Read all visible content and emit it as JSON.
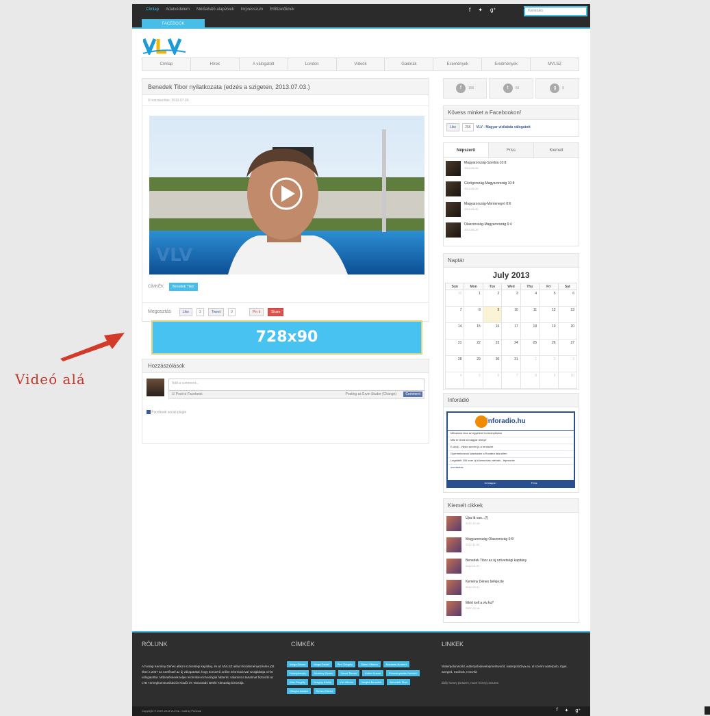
{
  "topbar": {
    "nav": [
      "Címlap",
      "Adatvédelem",
      "Médiaháló alapelvek",
      "Impresszum",
      "Előfizetőknek"
    ],
    "search_placeholder": "Keresés"
  },
  "facebook_tab": "FACEBOOK",
  "main_nav": [
    "Címlap",
    "Hírek",
    "A válogatott",
    "London",
    "Videók",
    "Galériák",
    "Események",
    "Eredmények",
    "MVLSZ"
  ],
  "article": {
    "title": "Benedek Tibor nyilatkozata (edzés a szigeten, 2013.07.03.)",
    "meta": "0 hozzászólás, 2013.07.03.",
    "tags_label": "CÍMKÉK:",
    "tag": "Benedek Tibor",
    "share_label": "Megosztás",
    "like": "Like",
    "like_count": "3",
    "tweet": "Tweet",
    "tweet_count": "0",
    "pin": "Pin it",
    "share": "Share"
  },
  "ad_banner": "728x90",
  "comments": {
    "title": "Hozzászólások",
    "placeholder": "Add a comment...",
    "post_to_fb": "Post to Facebook",
    "posting_as": "Posting as Ervin Studer (Change)",
    "comment_btn": "Comment",
    "plugin": "Facebook social plugin"
  },
  "annotation": "Videó alá",
  "social_counts": [
    {
      "icon": "facebook-icon",
      "glyph": "f",
      "count": "156"
    },
    {
      "icon": "twitter-icon",
      "glyph": "t",
      "count": "60"
    },
    {
      "icon": "googleplus-icon",
      "glyph": "g",
      "count": "0"
    }
  ],
  "facebook_follow": {
    "title": "Kövess minket a Facebookon!",
    "like_btn": "Like",
    "count": "256",
    "page_name": "VLV - Magyar vízilabda válogatott"
  },
  "popular": {
    "tabs": [
      "Népszerű",
      "Friss",
      "Kiemelt"
    ],
    "items": [
      {
        "title": "Magyarország-Szerbia 10:8",
        "date": "2013-06-28"
      },
      {
        "title": "Görögország-Magyarország 10:8",
        "date": "2013-06-29"
      },
      {
        "title": "Magyarország-Montenegró 8:6",
        "date": "2013-06-30"
      },
      {
        "title": "Olaszország-Magyarország 6:4",
        "date": "2013-06-29"
      }
    ]
  },
  "calendar": {
    "title": "Naptár",
    "month": "July 2013",
    "days": [
      "Sun",
      "Mon",
      "Tue",
      "Wed",
      "Thu",
      "Fri",
      "Sat"
    ],
    "weeks": [
      [
        "30",
        "1",
        "2",
        "3",
        "4",
        "5",
        "6"
      ],
      [
        "7",
        "8",
        "9",
        "10",
        "11",
        "12",
        "13"
      ],
      [
        "14",
        "15",
        "16",
        "17",
        "18",
        "19",
        "20"
      ],
      [
        "21",
        "22",
        "23",
        "24",
        "25",
        "26",
        "27"
      ],
      [
        "28",
        "29",
        "30",
        "31",
        "1",
        "2",
        "3"
      ],
      [
        "4",
        "5",
        "6",
        "7",
        "8",
        "9",
        "10"
      ]
    ]
  },
  "inforadio": {
    "title": "Inforádió",
    "brand": "inforadio.hu",
    "items": [
      "Mészáros lesz az egyetemi kormánybiztos",
      "Már le ülnek a magyar dinnye",
      "E-útdíj - Viktor szerint jó a rendszer",
      "Gyermekorvosi kaszkador a Rovátra lista ellen",
      "Legalább 100 ezer új közmunkás várható - lépcsonte"
    ],
    "more": "mentaatás",
    "footer_left": "Címlapon",
    "footer_right": "Friss"
  },
  "featured": {
    "title": "Kiemelt cikkek",
    "items": [
      {
        "title": "Újra itt van...(!)",
        "date": "2012-12-28"
      },
      {
        "title": "Magyarország-Olaszország 6:5!",
        "date": "2012-11-02"
      },
      {
        "title": "Benedek Tibor az új szövetségi kapitány",
        "date": "2012-01-01"
      },
      {
        "title": "Kemény Dénes befejezte",
        "date": "2012-09-21"
      },
      {
        "title": "Miért kell a vlv.hu?",
        "date": "2007-03-16"
      }
    ]
  },
  "footer": {
    "about_title": "RÓLUNK",
    "about_text": "A honlap Kemény Dénes akkori szövetségi kapitány, és az MVLSZ akkori kezdeményezésére jött létre a 2007 as szeléssel az új válogatottal, hogy korszerű online információval szolgáltatja a hírt válogatottat. Működésének teljes technikai-technológiai hátterét, valamint a tartalmat biztosító az LTB Tömegkommunikációs Kiadói és Tanácsadó Betéti Társaság biztosítja.",
    "tags_title": "CÍMKÉK",
    "tags": [
      "Varga Dénes",
      "Varga Dániel",
      "Biro Gergely",
      "Steinz Márton",
      "Madaras Norbert",
      "Hosnyánszky",
      "Kemény Dénes",
      "Decsi Tamás",
      "Kobra Kossa",
      "Pressanyiadás Norbert",
      "Kiss Gergely",
      "Gergely Károly",
      "Vízi Vilmos",
      "Vargha Benedek",
      "Benedek Tibor",
      "Olimpia Adatok",
      "Szécsi Zoltán"
    ],
    "links_title": "LINKEK",
    "links_text": "Waterpolonworld, waterpolodevelopmentworld, waterpoloDiva.eu, al szerint waterpolo, Eger, Szeged, Szolnok, Honvéd",
    "links_text2": "daily honey pictures, more honey pictures",
    "copyright": "Copyright © 2007-2013 VLV.hu - built by Percival"
  }
}
